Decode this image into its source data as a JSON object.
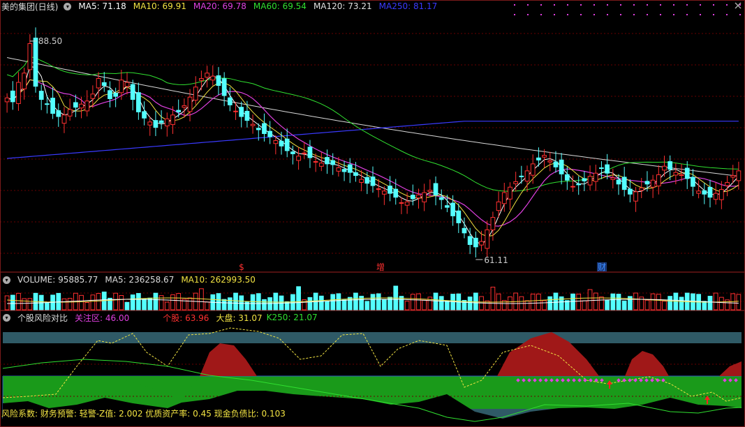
{
  "main": {
    "title": "美的集团(日线)",
    "ma": [
      {
        "label": "MA5: 71.18",
        "color": "#ffffff"
      },
      {
        "label": "MA10: 69.91",
        "color": "#f2e342"
      },
      {
        "label": "MA20: 69.78",
        "color": "#e040e0"
      },
      {
        "label": "MA60: 69.54",
        "color": "#30e030"
      },
      {
        "label": "MA120: 73.21",
        "color": "#e0e0e0"
      },
      {
        "label": "MA250: 81.17",
        "color": "#3a3aff"
      }
    ],
    "high_label": "88.50",
    "low_label": "61.11",
    "markers": [
      {
        "text": "$",
        "color": "#ff3030"
      },
      {
        "text": "增",
        "color": "#ff3030"
      },
      {
        "text": "财",
        "color": "#3a8cff"
      }
    ]
  },
  "volume": {
    "title": "VOLUME: 95885.77",
    "ma5": "MA5: 236258.67",
    "ma10": "MA10: 262993.50"
  },
  "risk": {
    "title": "个股风险对比",
    "focus": "关注区: 46.00",
    "stock": "个股: 63.96",
    "market": "大盘: 31.07",
    "k250": "K250: 21.07"
  },
  "footer": "风险系数: 财务预警: 轻警-Z值: 2.002 优质资产率: 0.45 现金负债比: 0.103",
  "colors": {
    "up": "#ff3030",
    "down": "#54ffff",
    "grid": "#6a0000"
  },
  "chart_data": {
    "type": "candlestick",
    "annotations": [
      "88.50",
      "61.11"
    ],
    "close": [
      81.0,
      80.5,
      83.0,
      84.2,
      88.0,
      82.5,
      80.8,
      80.2,
      79.0,
      78.6,
      78.8,
      79.5,
      79.8,
      80.2,
      80.6,
      81.5,
      83.5,
      82.6,
      80.9,
      81.2,
      83.3,
      83.0,
      80.8,
      79.2,
      78.4,
      77.9,
      77.2,
      77.8,
      78.3,
      78.8,
      79.2,
      80.0,
      81.1,
      82.4,
      83.5,
      84.2,
      83.8,
      82.6,
      81.3,
      80.1,
      79.3,
      78.6,
      78.1,
      77.6,
      76.9,
      76.4,
      76.0,
      75.5,
      74.8,
      74.2,
      73.8,
      73.5,
      73.9,
      73.3,
      72.8,
      72.6,
      72.5,
      72.4,
      72.0,
      71.5,
      71.4,
      71.0,
      70.5,
      70.0,
      69.7,
      69.3,
      69.0,
      68.7,
      68.2,
      67.5,
      67.6,
      68.0,
      68.5,
      68.8,
      69.1,
      68.5,
      67.9,
      66.9,
      65.8,
      64.9,
      63.6,
      62.1,
      61.8,
      62.5,
      64.0,
      65.6,
      67.6,
      68.8,
      69.5,
      70.2,
      70.9,
      71.6,
      72.5,
      73.0,
      73.6,
      72.9,
      72.1,
      71.2,
      70.4,
      69.6,
      69.8,
      70.3,
      70.9,
      71.3,
      71.9,
      71.3,
      70.7,
      69.9,
      69.2,
      68.6,
      68.9,
      69.4,
      69.9,
      70.4,
      71.1,
      72.2,
      71.8,
      71.4,
      71.1,
      70.6,
      69.6,
      69.0,
      68.6,
      68.2,
      68.7,
      69.2,
      70.1,
      71.0,
      71.6
    ]
  }
}
